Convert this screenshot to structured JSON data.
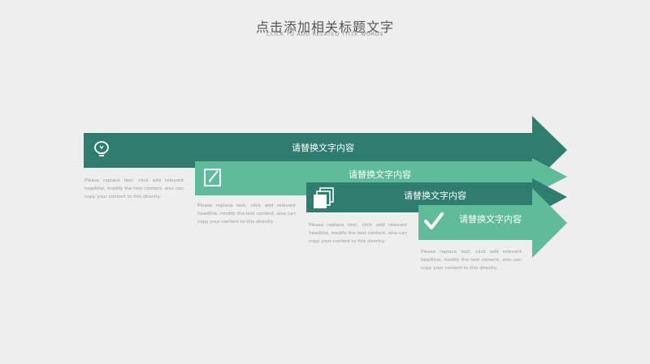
{
  "header": {
    "title": "点击添加相关标题文字",
    "subtitle": "CLICK TO ADD RELATED TITLE WORDS"
  },
  "colors": {
    "dark_teal": "#2e7d6e",
    "light_teal": "#5ebd98",
    "background": "#eeeeee"
  },
  "steps": [
    {
      "label": "请替换文字内容",
      "icon": "lightbulb-icon",
      "description": "Please replace text, click add relevant headline, modify the text content, also can copy your content to this directly."
    },
    {
      "label": "请替换文字内容",
      "icon": "edit-note-icon",
      "description": "Please replace text, click add relevant headline, modify the text content, also can copy your content to this directly."
    },
    {
      "label": "请替换文字内容",
      "icon": "stacked-pages-icon",
      "description": "Please replace text, click add relevant headline, modify the text content, also can copy your content to this directly."
    },
    {
      "label": "请替换文字内容",
      "icon": "checkmark-icon",
      "description": "Please replace text, click add relevant headline, modify the text content, also can copy your content to this directly."
    }
  ]
}
